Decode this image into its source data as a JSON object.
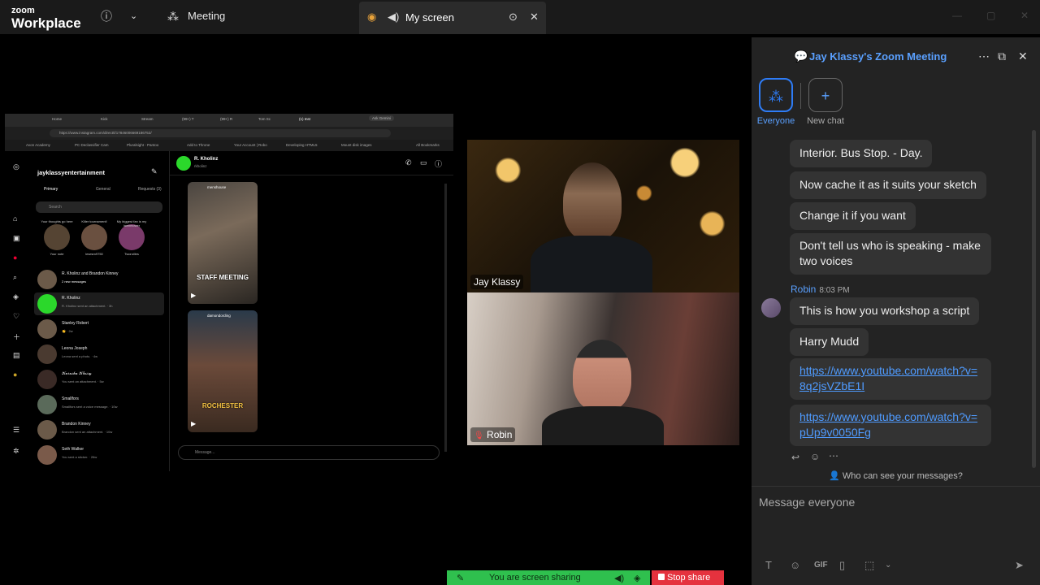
{
  "topbar": {
    "logo_line1": "zoom",
    "logo_line2": "Workplace",
    "meeting_tab": "Meeting",
    "screen_tab": "My screen"
  },
  "shared_screen": {
    "browser_tabs": [
      "Home",
      "Kick",
      "Stream",
      "(99+) T",
      "(99+) R",
      "Tom Sc",
      "(1) Inst",
      "Ask Gemini"
    ],
    "url": "https://www.instagram.com/direct/t/17846006669186752/",
    "bookmarks": [
      "Avon Academy",
      "PC Declassifier Cam",
      "Pluralsight - Pantoo",
      "Add to Throne",
      "Your Account | Robo",
      "Developing HTML5",
      "Mount disk images",
      "All Bookmarks"
    ],
    "account": "jayklassyentertainment",
    "tabs": [
      "Primary",
      "General",
      "Requests (3)"
    ],
    "search_placeholder": "Search",
    "notes": [
      {
        "text": "Your thoughts go here",
        "label": "Your note"
      },
      {
        "text": "Killer tournament!",
        "label": "lesesm9750"
      },
      {
        "text": "My biggest fan is my lawnmower",
        "label": "Tworoilles"
      }
    ],
    "dms": [
      {
        "name": "R. Kholinz and Brandon Kinney",
        "preview": "2 new messages"
      },
      {
        "name": "R. Kholinz",
        "preview": "R. Kholinz sent an attachment. · 3h"
      },
      {
        "name": "Stanley Robert",
        "preview": "👏 · 2w"
      },
      {
        "name": "Leona Joseph",
        "preview": "Leona sent a photo. · 4w"
      },
      {
        "name": "𝒦𝒶𝓇𝒶𝓈𝒽𝒶 𝒦𝓁𝒶𝓈𝓈𝓎",
        "preview": "You sent an attachment. · 5w"
      },
      {
        "name": "Smallfors",
        "preview": "Smallfors sent a voice message. · 10w"
      },
      {
        "name": "Brandon Kinney",
        "preview": "Brandon sent an attachment. · 10w"
      },
      {
        "name": "Seth Walker",
        "preview": "You sent a sticker. · 26w"
      }
    ],
    "chat_name": "R. Kholinz",
    "chat_handle": "rkholinz",
    "reels": [
      {
        "handle": "menshouse",
        "caption": "STAFF MEETING"
      },
      {
        "handle": "damondording",
        "caption": "ROCHESTER"
      }
    ],
    "message_placeholder": "Message..."
  },
  "videos": [
    {
      "name": "Jay Klassy"
    },
    {
      "name": "Robin"
    }
  ],
  "chat_panel": {
    "title": "Jay Klassy's Zoom Meeting",
    "tiles": [
      {
        "label": "Everyone"
      },
      {
        "label": "New chat"
      }
    ],
    "messages": [
      {
        "text": "Interior. Bus Stop. - Day."
      },
      {
        "text": "Now cache it as it suits your sketch"
      },
      {
        "text": "Change it if you want"
      },
      {
        "text": "Don't tell us who is speaking - make two voices"
      },
      {
        "text": "This is how you workshop a script"
      },
      {
        "text": "Harry Mudd"
      },
      {
        "text": "https://www.youtube.com/watch?v=8q2jsVZbE1I"
      },
      {
        "text": "https://www.youtube.com/watch?v=pUp9v0050Fg"
      }
    ],
    "sender": {
      "name": "Robin",
      "time": "8:03 PM"
    },
    "privacy_text": "Who can see your messages?",
    "compose_placeholder": "Message everyone",
    "gif_label": "GIF"
  },
  "sharing": {
    "status": "You are screen sharing",
    "stop_label": "Stop share"
  },
  "colors": {
    "accent_blue": "#5aa0ff",
    "share_green": "#2fc04e",
    "stop_red": "#e5323e"
  }
}
